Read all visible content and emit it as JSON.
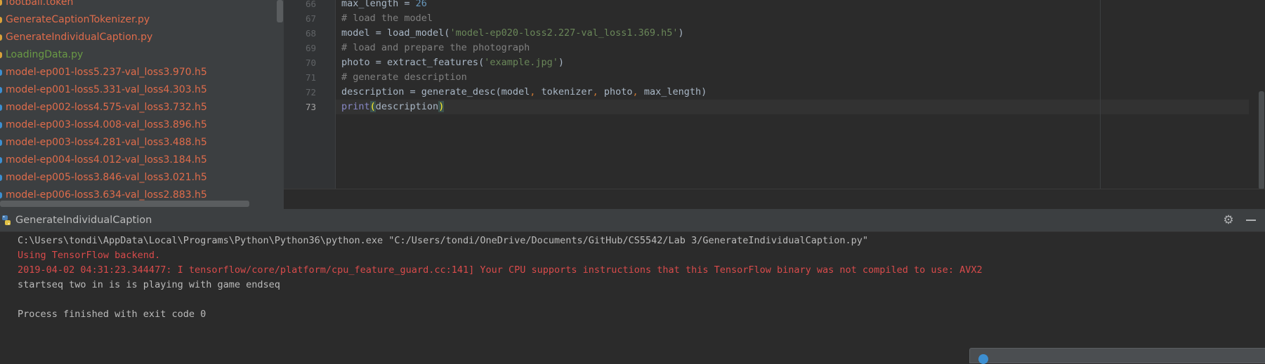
{
  "colors": {
    "py_file": "#e06c4b",
    "py_file_modified": "#6a9a45",
    "h5_file": "#e06c4b",
    "token_file": "#e06c4b",
    "marker_py": "#d9a13a",
    "marker_h5": "#3d8fd1"
  },
  "project_tree": {
    "items": [
      {
        "label": "football.token",
        "kind": "token"
      },
      {
        "label": "GenerateCaptionTokenizer.py",
        "kind": "py"
      },
      {
        "label": "GenerateIndividualCaption.py",
        "kind": "py"
      },
      {
        "label": "LoadingData.py",
        "kind": "py_modified"
      },
      {
        "label": "model-ep001-loss5.237-val_loss3.970.h5",
        "kind": "h5"
      },
      {
        "label": "model-ep001-loss5.331-val_loss4.303.h5",
        "kind": "h5"
      },
      {
        "label": "model-ep002-loss4.575-val_loss3.732.h5",
        "kind": "h5"
      },
      {
        "label": "model-ep003-loss4.008-val_loss3.896.h5",
        "kind": "h5"
      },
      {
        "label": "model-ep003-loss4.281-val_loss3.488.h5",
        "kind": "h5"
      },
      {
        "label": "model-ep004-loss4.012-val_loss3.184.h5",
        "kind": "h5"
      },
      {
        "label": "model-ep005-loss3.846-val_loss3.021.h5",
        "kind": "h5"
      },
      {
        "label": "model-ep006-loss3.634-val_loss2.883.h5",
        "kind": "h5"
      }
    ]
  },
  "editor": {
    "lines": [
      {
        "num": "66",
        "tokens": [
          {
            "t": "max_length = ",
            "c": ""
          },
          {
            "t": "26",
            "c": "number"
          }
        ]
      },
      {
        "num": "67",
        "tokens": [
          {
            "t": "# load the model",
            "c": "comment"
          }
        ]
      },
      {
        "num": "68",
        "tokens": [
          {
            "t": "model = load_model(",
            "c": ""
          },
          {
            "t": "'model-ep020-loss2.227-val_loss1.369.h5'",
            "c": "string"
          },
          {
            "t": ")",
            "c": ""
          }
        ]
      },
      {
        "num": "69",
        "tokens": [
          {
            "t": "# load and prepare the photograph",
            "c": "comment"
          }
        ]
      },
      {
        "num": "70",
        "tokens": [
          {
            "t": "photo = extract_features(",
            "c": ""
          },
          {
            "t": "'example.jpg'",
            "c": "string"
          },
          {
            "t": ")",
            "c": ""
          }
        ]
      },
      {
        "num": "71",
        "tokens": [
          {
            "t": "# generate description",
            "c": "comment"
          }
        ]
      },
      {
        "num": "72",
        "tokens": [
          {
            "t": "description = generate_desc(model",
            "c": ""
          },
          {
            "t": ", ",
            "c": "punct"
          },
          {
            "t": "tokenizer",
            "c": ""
          },
          {
            "t": ", ",
            "c": "punct"
          },
          {
            "t": "photo",
            "c": ""
          },
          {
            "t": ", ",
            "c": "punct"
          },
          {
            "t": "max_length)",
            "c": ""
          }
        ]
      },
      {
        "num": "73",
        "tokens": [
          {
            "t": "print",
            "c": "builtin"
          },
          {
            "t": "(",
            "c": "parenhl"
          },
          {
            "t": "description",
            "c": ""
          },
          {
            "t": ")",
            "c": "parenhl"
          }
        ]
      }
    ],
    "current_line": "73"
  },
  "run_window": {
    "tab_label": "GenerateIndividualCaption",
    "settings_icon": "gear-icon",
    "minimize_icon": "minimize-icon"
  },
  "console": {
    "lines": [
      {
        "text": "C:\\Users\\tondi\\AppData\\Local\\Programs\\Python\\Python36\\python.exe \"C:/Users/tondi/OneDrive/Documents/GitHub/CS5542/Lab 3/GenerateIndividualCaption.py\"",
        "kind": "cmd"
      },
      {
        "text": "Using TensorFlow backend.",
        "kind": "err"
      },
      {
        "text": "2019-04-02 04:31:23.344477: I tensorflow/core/platform/cpu_feature_guard.cc:141] Your CPU supports instructions that this TensorFlow binary was not compiled to use: AVX2",
        "kind": "err"
      },
      {
        "text": "startseq two in is is playing with game endseq",
        "kind": "out"
      },
      {
        "text": "",
        "kind": "out"
      },
      {
        "text": "Process finished with exit code 0",
        "kind": "out"
      }
    ]
  }
}
